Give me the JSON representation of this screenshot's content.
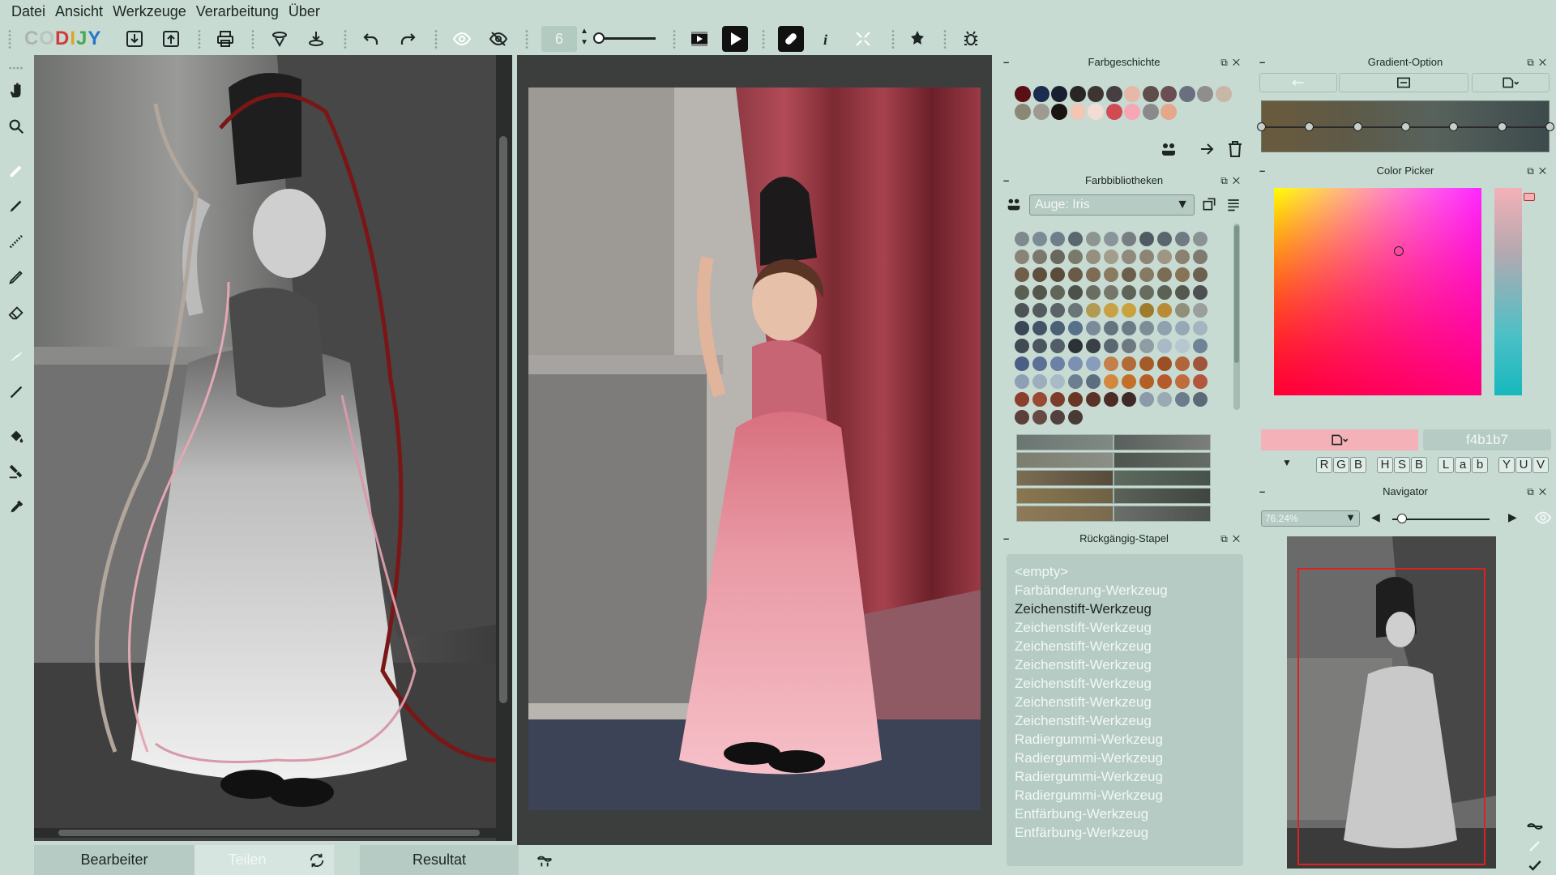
{
  "menu": [
    "Datei",
    "Ansicht",
    "Werkzeuge",
    "Verarbeitung",
    "Über"
  ],
  "toolbar": {
    "logo": "CODIJY",
    "brush_size": "6",
    "icons": [
      "import-icon",
      "export-icon",
      "print-icon",
      "colorize-tool-icon",
      "transfer-icon",
      "undo-icon",
      "redo-icon",
      "eye-icon",
      "hide-eye-icon",
      "film-play-icon",
      "play-icon",
      "link-icon",
      "info-icon",
      "expand-icon",
      "settings-icon",
      "bug-icon"
    ]
  },
  "left_tools": [
    "dots-icon",
    "hand-icon",
    "zoom-icon",
    "eraser-tool-icon",
    "pen-icon",
    "dotted-pen-icon",
    "pencil-icon",
    "eraser-icon",
    "brush-stroke-icon",
    "line-icon",
    "fill-icon",
    "stamp-icon",
    "eyedropper-icon"
  ],
  "bottom_tabs": {
    "editor": "Bearbeiter",
    "split": "Teilen",
    "result": "Resultat"
  },
  "colors": {
    "background": "#c7dbd3",
    "accent_pink": "#f4b1b7",
    "dark_pane": "#3a3e3d",
    "navigator_frame": "#e02020"
  },
  "history_panel": {
    "title": "Farbgeschichte",
    "swatches": [
      "#5a0f14",
      "#1b2d4f",
      "#1a1f2f",
      "#2a2624",
      "#3e3431",
      "#463e40",
      "#e6b8a8",
      "#5d4d4b",
      "#6a4e54",
      "#6a6f80",
      "#8f8e8a",
      "#c8b7a7",
      "#8a8774",
      "#9e9a92",
      "#1b1212",
      "#f1c6b4",
      "#f3dcd4",
      "#d14c52",
      "#f6a6b5",
      "#8b8a8a",
      "#e4a78a"
    ]
  },
  "library_panel": {
    "title": "Farbbibliotheken",
    "dropdown": "Auge: Iris",
    "grid": [
      [
        "#7f8a8e",
        "#7c8b96",
        "#6f7f8a",
        "#5c6670",
        "#8d9591",
        "#8b949a",
        "#767e82",
        "#4f5a62",
        "#59666e",
        "#707a82",
        "#8a9293"
      ],
      [
        "#8a8478",
        "#7b776d",
        "#6a675f",
        "#7a7a6c",
        "#958f7e",
        "#a29d8c",
        "#8f8a7c",
        "#8c8577",
        "#9e9582",
        "#8a8170",
        "#7f7a6e"
      ],
      [
        "#6f5e48",
        "#5f4f3d",
        "#5a4b3a",
        "#6a5a46",
        "#7e6c54",
        "#8a7a60",
        "#6b5f4b",
        "#867a62",
        "#7a6c55",
        "#877356",
        "#6c604f"
      ],
      [
        "#5b5f52",
        "#525749",
        "#606556",
        "#4c5248",
        "#6a6e60",
        "#76776a",
        "#5f6357",
        "#686c5f",
        "#5c6156",
        "#55584e",
        "#4c5050"
      ],
      [
        "#4c5456",
        "#535b5e",
        "#5a6366",
        "#6b7476",
        "#b39a53",
        "#c8a144",
        "#c9a23f",
        "#9f7c2c",
        "#b88c34",
        "#8f8f7a",
        "#9a9e9c"
      ],
      [
        "#3a4556",
        "#445267",
        "#4b6075",
        "#57708c",
        "#7b8b9a",
        "#64747f",
        "#6b7b86",
        "#7d8d96",
        "#8fa1ad",
        "#96a8b5",
        "#a4b5bf"
      ],
      [
        "#404a52",
        "#4a555e",
        "#525e67",
        "#2c3136",
        "#394046",
        "#5b6770",
        "#6d7880",
        "#8f9ca3",
        "#a8bac5",
        "#b7c7d0",
        "#6d8496"
      ],
      [
        "#4b5f86",
        "#5c6f96",
        "#6b82a6",
        "#7a91b3",
        "#879dbb",
        "#c47f4a",
        "#b26a36",
        "#a55a2a",
        "#9c4f23",
        "#b1663a",
        "#9f553a"
      ],
      [
        "#8f9fb3",
        "#9cadbe",
        "#a8bac6",
        "#6c7e90",
        "#5d6e80",
        "#d3883b",
        "#c36f2a",
        "#b35f25",
        "#b65a2c",
        "#c06c3c",
        "#b2573e"
      ],
      [
        "#8a3f2c",
        "#9a4934",
        "#7d3c2b",
        "#6a3727",
        "#5c3228",
        "#4c2c24",
        "#3e2a25",
        "#8b99a8",
        "#9ba9b5",
        "#6d7c8b",
        "#5c6a78"
      ],
      [
        "#5c3f3b",
        "#674944",
        "#52403c",
        "#4a3a36"
      ]
    ],
    "gradients": [
      [
        "#6b7673",
        "#808a84"
      ],
      [
        "#595f5c",
        "#7a7f7b"
      ],
      [
        "#7c7d6e",
        "#8b8f87"
      ],
      [
        "#4e554f",
        "#656c66"
      ],
      [
        "#7b6e54",
        "#564a3b"
      ],
      [
        "#5d6a5e",
        "#46524b"
      ],
      [
        "#8a7751",
        "#6f6244"
      ],
      [
        "#5b6258",
        "#3f453f"
      ],
      [
        "#8e7a58",
        "#7a6a4d"
      ],
      [
        "#6a6f6a",
        "#4d524d"
      ]
    ]
  },
  "undo_panel": {
    "title": "Rückgängig-Stapel",
    "items": [
      {
        "label": "<empty>",
        "active": false
      },
      {
        "label": "Farbänderung-Werkzeug",
        "active": false
      },
      {
        "label": "Zeichenstift-Werkzeug",
        "active": true
      },
      {
        "label": "Zeichenstift-Werkzeug",
        "active": false
      },
      {
        "label": "Zeichenstift-Werkzeug",
        "active": false
      },
      {
        "label": "Zeichenstift-Werkzeug",
        "active": false
      },
      {
        "label": "Zeichenstift-Werkzeug",
        "active": false
      },
      {
        "label": "Zeichenstift-Werkzeug",
        "active": false
      },
      {
        "label": "Zeichenstift-Werkzeug",
        "active": false
      },
      {
        "label": "Radiergummi-Werkzeug",
        "active": false
      },
      {
        "label": "Radiergummi-Werkzeug",
        "active": false
      },
      {
        "label": "Radiergummi-Werkzeug",
        "active": false
      },
      {
        "label": "Radiergummi-Werkzeug",
        "active": false
      },
      {
        "label": "Entfärbung-Werkzeug",
        "active": false
      },
      {
        "label": "Entfärbung-Werkzeug",
        "active": false
      }
    ]
  },
  "gradient_panel": {
    "title": "Gradient-Option",
    "stops": 7
  },
  "color_picker": {
    "title": "Color Picker",
    "hex": "f4b1b7",
    "current_color": "#f4b1b7",
    "modes": [
      [
        "R",
        "G",
        "B"
      ],
      [
        "H",
        "S",
        "B"
      ],
      [
        "L",
        "a",
        "b"
      ],
      [
        "Y",
        "U",
        "V"
      ]
    ]
  },
  "navigator": {
    "title": "Navigator",
    "zoom": "76.24%"
  }
}
